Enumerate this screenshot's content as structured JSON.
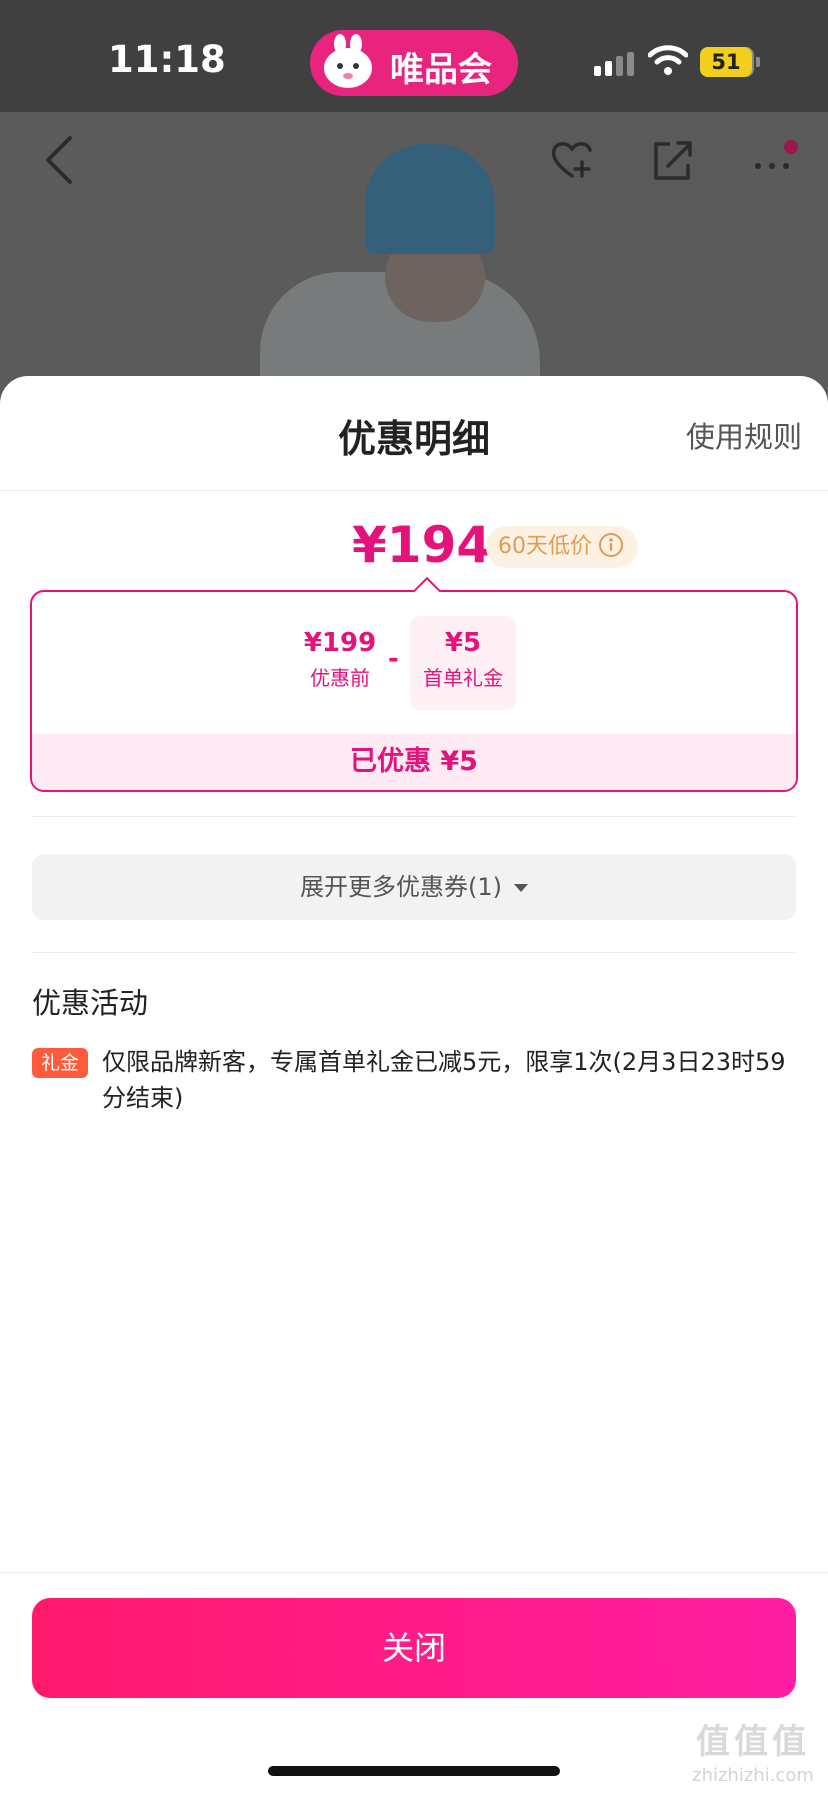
{
  "status_bar": {
    "time": "11:18",
    "app_badge": "唯品会",
    "battery": "51",
    "signal_bars": 2,
    "signal_max": 4,
    "accent_color": "#e8247e"
  },
  "nav": {
    "back_icon": "chevron-left-icon",
    "favorite_icon": "heart-plus-icon",
    "share_icon": "share-icon",
    "more_icon": "more-icon"
  },
  "sheet": {
    "title": "优惠明细",
    "rules_link": "使用规则",
    "final_price": "¥194",
    "low_price_badge": "60天低价",
    "breakdown": {
      "before_amount": "¥199",
      "before_label": "优惠前",
      "operator": "-",
      "coupon_amount": "¥5",
      "coupon_label": "首单礼金",
      "saved_text": "已优惠 ¥5"
    },
    "expand_coupons": "展开更多优惠券(1)",
    "activity_title": "优惠活动",
    "activity": {
      "tag": "礼金",
      "text": "仅限品牌新客，专属首单礼金已减5元，限享1次(2月3日23时59分结束)"
    },
    "close_button": "关闭",
    "brand_color": "#e5127c"
  },
  "watermark": {
    "glyphs": "值值值",
    "url": "zhizhizhi.com"
  }
}
